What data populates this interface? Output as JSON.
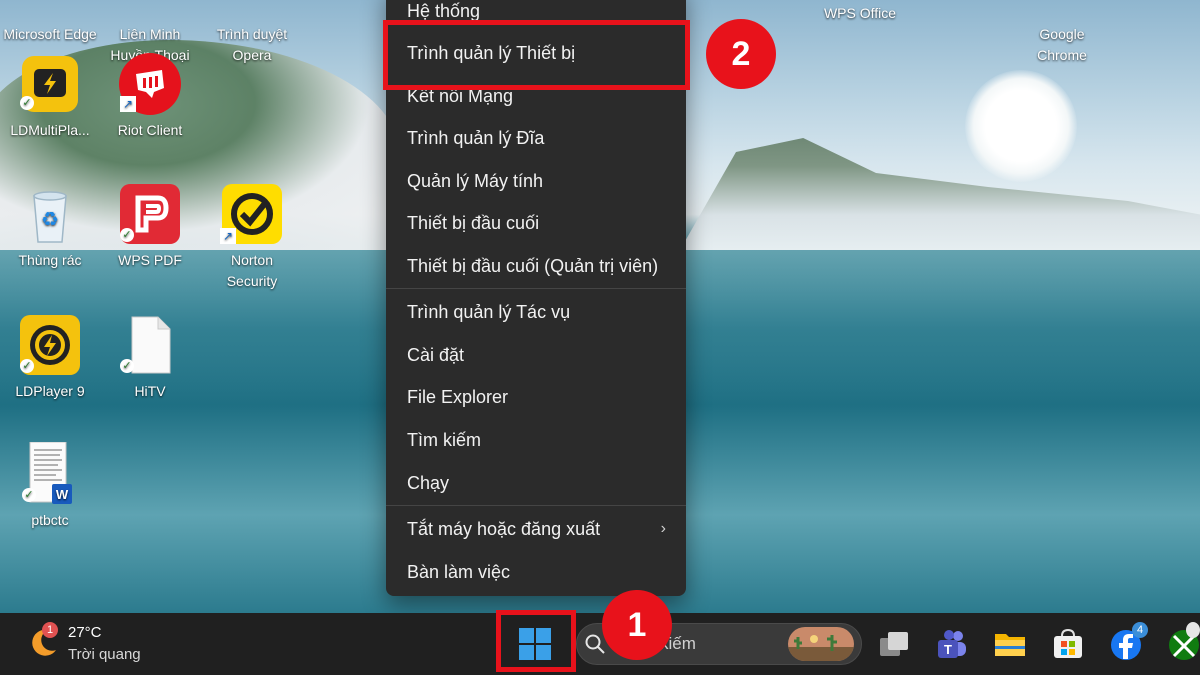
{
  "desktop_icons": [
    {
      "label": "Microsoft Edge",
      "icon": "edge-icon"
    },
    {
      "label": "Liên Minh Huyền Thoại",
      "icon": "lol-icon"
    },
    {
      "label": "Trình duyệt Opera",
      "icon": "opera-icon"
    },
    {
      "label": "WPS Office",
      "icon": "wps-office-icon"
    },
    {
      "label": "Google Chrome",
      "icon": "chrome-icon"
    },
    {
      "label": "LDMultiPla...",
      "icon": "ldmultiplayer-icon"
    },
    {
      "label": "Riot Client",
      "icon": "riot-client-icon"
    },
    {
      "label": "Thùng rác",
      "icon": "recycle-bin-icon"
    },
    {
      "label": "WPS PDF",
      "icon": "wps-pdf-icon"
    },
    {
      "label": "Norton Security",
      "icon": "norton-icon"
    },
    {
      "label": "LDPlayer 9",
      "icon": "ldplayer-icon"
    },
    {
      "label": "HiTV",
      "icon": "file-icon"
    },
    {
      "label": "ptbctc",
      "icon": "word-document-icon"
    }
  ],
  "context_menu": {
    "items": [
      "Hệ thống",
      "Trình quản lý Thiết bị",
      "Kết nối Mạng",
      "Trình quản lý Đĩa",
      "Quản lý Máy tính",
      "Thiết bị đầu cuối",
      "Thiết bị đầu cuối (Quản trị viên)",
      "Trình quản lý Tác vụ",
      "Cài đặt",
      "File Explorer",
      "Tìm kiếm",
      "Chạy",
      "Tắt máy hoặc đăng xuất",
      "Bàn làm việc"
    ],
    "submenu_chevron": "›",
    "highlighted_item": "Trình quản lý Thiết bị"
  },
  "step_badges": {
    "start_step": "1",
    "menu_step": "2"
  },
  "taskbar": {
    "weather_temp": "27°C",
    "weather_desc": "Trời quang",
    "weather_alert_count": "1",
    "search_text": "kiếm",
    "teams_badge": "",
    "facebook_badge": "4"
  },
  "colors": {
    "annotation_red": "#e8121b",
    "menu_bg": "#2b2b2b",
    "taskbar_bg": "#202020",
    "windows_blue": "#3aa0e8"
  }
}
